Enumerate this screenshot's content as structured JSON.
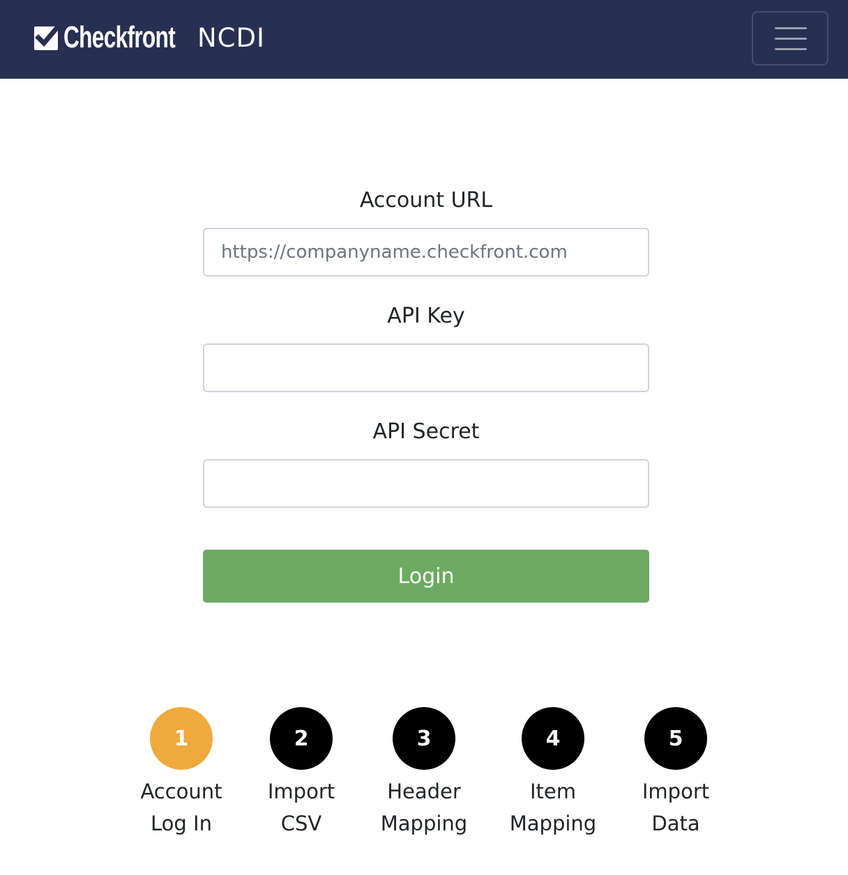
{
  "header": {
    "logo_text": "Checkfront",
    "app_name": "NCDI",
    "background_color": "#272f52",
    "menu_icon": "hamburger-icon"
  },
  "form": {
    "account_url": {
      "label": "Account URL",
      "placeholder": "https://companyname.checkfront.com",
      "value": ""
    },
    "api_key": {
      "label": "API Key",
      "value": ""
    },
    "api_secret": {
      "label": "API Secret",
      "value": ""
    },
    "login_button": {
      "label": "Login",
      "color": "#6dab63"
    }
  },
  "steps": {
    "active_color": "#efa93c",
    "inactive_color": "#000000",
    "items": [
      {
        "number": "1",
        "line1": "Account",
        "line2": "Log In",
        "active": true
      },
      {
        "number": "2",
        "line1": "Import",
        "line2": "CSV",
        "active": false
      },
      {
        "number": "3",
        "line1": "Header",
        "line2": "Mapping",
        "active": false
      },
      {
        "number": "4",
        "line1": "Item",
        "line2": "Mapping",
        "active": false
      },
      {
        "number": "5",
        "line1": "Import",
        "line2": "Data",
        "active": false
      }
    ]
  }
}
